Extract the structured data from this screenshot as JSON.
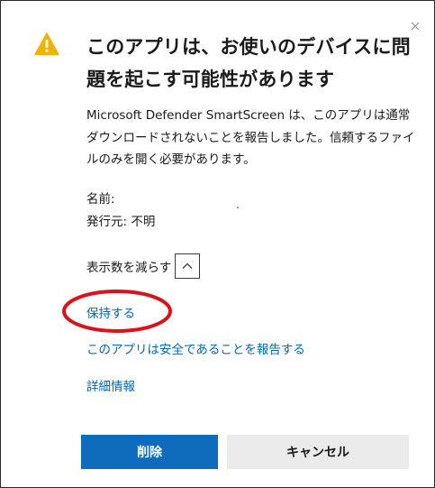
{
  "dialog": {
    "title": "このアプリは、お使いのデバイスに問題を起こす可能性があります",
    "message": "Microsoft Defender SmartScreen は、このアプリは通常ダウンロードされないことを報告しました。信頼するファイルのみを開く必要があります。",
    "name_label": "名前:",
    "publisher_line": "発行元: 不明",
    "show_less_label": "表示数を減らす",
    "links": {
      "keep": "保持する",
      "report_safe": "このアプリは安全であることを報告する",
      "details": "詳細情報"
    },
    "buttons": {
      "delete": "削除",
      "cancel": "キャンセル"
    }
  },
  "icons": {
    "warning": "warning-icon",
    "close": "close-icon",
    "chevron": "chevron-up-icon"
  },
  "colors": {
    "warning": "#f0b400",
    "link": "#0067b8",
    "primary_button": "#0f6cbd",
    "secondary_button": "#ebebeb",
    "annotation": "#d9131c"
  }
}
